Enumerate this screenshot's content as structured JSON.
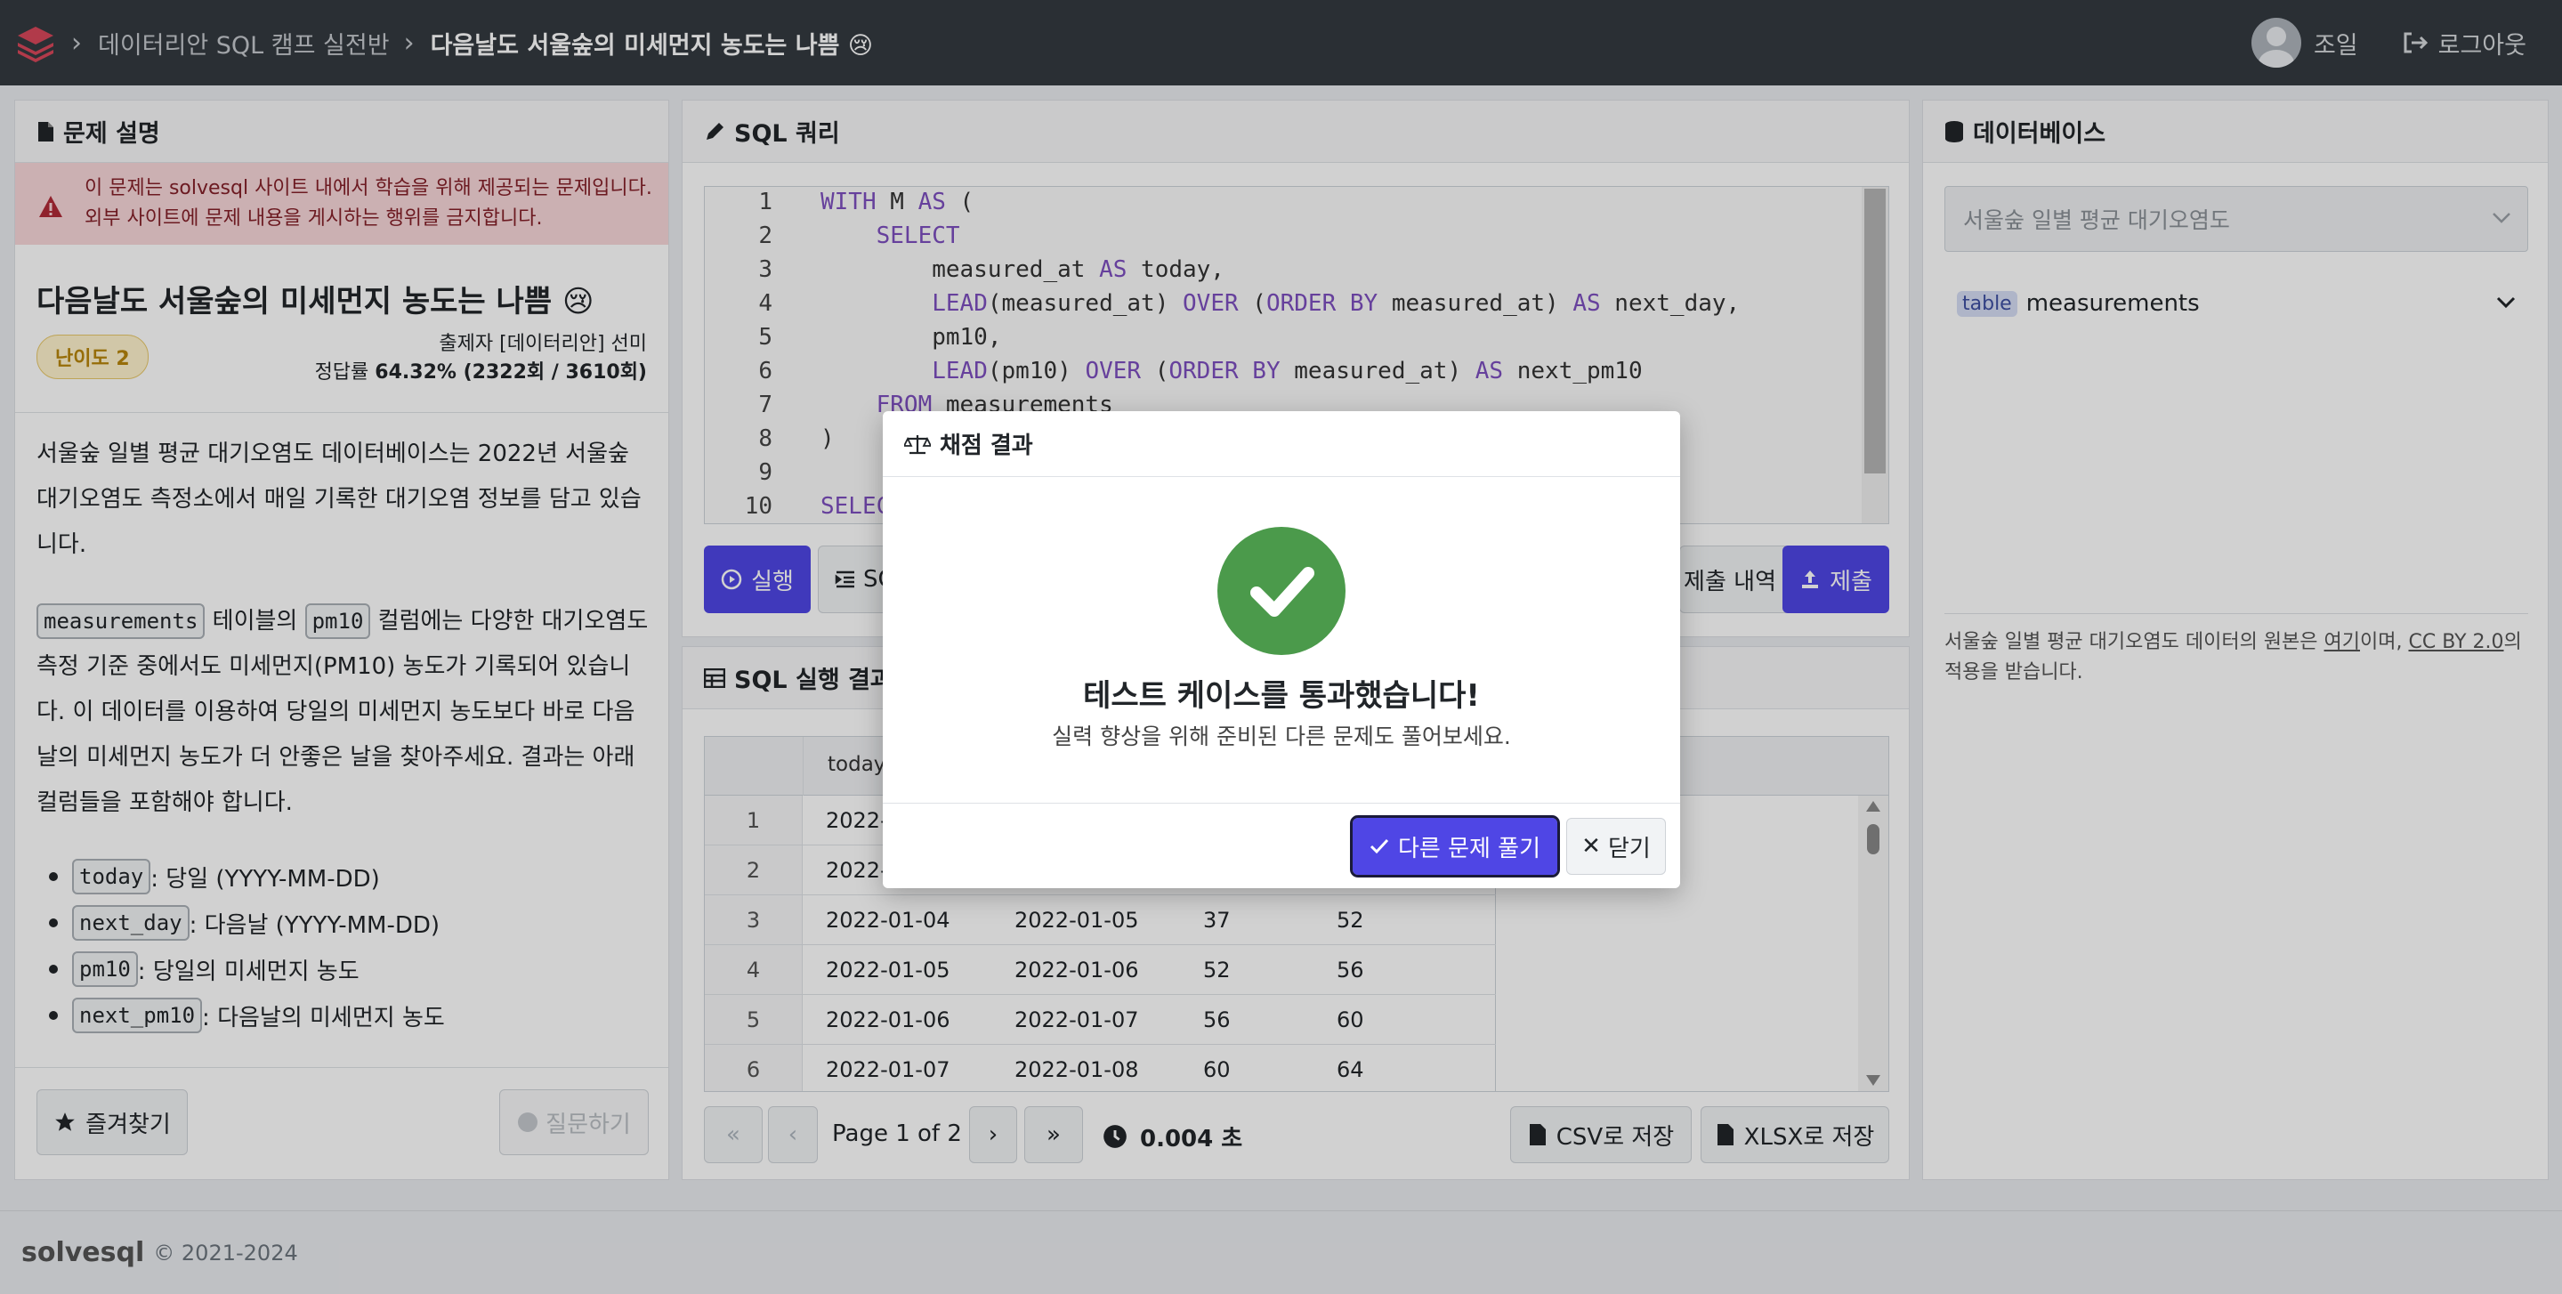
{
  "header": {
    "breadcrumb_course": "데이터리안 SQL 캠프 실전반",
    "breadcrumb_problem": "다음날도 서울숲의 미세먼지 농도는 나쁨 😢",
    "user_name": "조일",
    "logout_label": "로그아웃"
  },
  "left_panel": {
    "title": "문제 설명",
    "alert_line1": "이 문제는 solvesql 사이트 내에서 학습을 위해 제공되는 문제입니다.",
    "alert_line2": "외부 사이트에 문제 내용을 게시하는 행위를 금지합니다.",
    "problem_title": "다음날도 서울숲의 미세먼지 농도는 나쁨 😢",
    "difficulty": "난이도 2",
    "author_label": "출제자",
    "author": "[데이터리안] 선미",
    "accuracy_label": "정답률",
    "accuracy": "64.32% (2322회 / 3610회)",
    "desc_p1": "서울숲 일별 평균 대기오염도 데이터베이스는 2022년 서울숲 대기오염도 측정소에서 매일 기록한 대기오염 정보를 담고 있습니다.",
    "desc_p2_chip1": "measurements",
    "desc_p2_text1": " 테이블의 ",
    "desc_p2_chip2": "pm10",
    "desc_p2_text2": " 컬럼에는 다양한 대기오염도 측정 기준 중에서도 미세먼지(PM10) 농도가 기록되어 있습니다. 이 데이터를 이용하여 당일의 미세먼지 농도보다 바로 다음날의 미세먼지 농도가 더 안좋은 날을 찾아주세요. 결과는 아래 컬럼들을 포함해야 합니다.",
    "bullets": [
      {
        "code": "today",
        "text": ": 당일 (YYYY-MM-DD)"
      },
      {
        "code": "next_day",
        "text": ": 다음날 (YYYY-MM-DD)"
      },
      {
        "code": "pm10",
        "text": ": 당일의 미세먼지 농도"
      },
      {
        "code": "next_pm10",
        "text": ": 다음날의 미세먼지 농도"
      }
    ],
    "bookmark_label": "즐겨찾기",
    "question_label": "질문하기"
  },
  "sql_panel": {
    "title": "SQL 쿼리",
    "line_numbers": [
      "1",
      "2",
      "3",
      "4",
      "5",
      "6",
      "7",
      "8",
      "9",
      "10"
    ],
    "run_label": "실행",
    "format_label_visible": "SQ",
    "history_label_visible": "제출 내역",
    "submit_label": "제출"
  },
  "result_panel": {
    "title_visible": "SQL 실행 결과",
    "col_today_visible": "today",
    "rows": [
      {
        "n": "1",
        "today": "2022-",
        "next_day": "",
        "pm10": "",
        "next_pm10": ""
      },
      {
        "n": "2",
        "today": "2022-",
        "next_day": "",
        "pm10": "",
        "next_pm10": ""
      },
      {
        "n": "3",
        "today": "2022-01-04",
        "next_day": "2022-01-05",
        "pm10": "37",
        "next_pm10": "52"
      },
      {
        "n": "4",
        "today": "2022-01-05",
        "next_day": "2022-01-06",
        "pm10": "52",
        "next_pm10": "56"
      },
      {
        "n": "5",
        "today": "2022-01-06",
        "next_day": "2022-01-07",
        "pm10": "56",
        "next_pm10": "60"
      },
      {
        "n": "6",
        "today": "2022-01-07",
        "next_day": "2022-01-08",
        "pm10": "60",
        "next_pm10": "64"
      }
    ],
    "page_info": "Page 1 of 2",
    "elapsed": "0.004 초",
    "csv_label": "CSV로 저장",
    "xlsx_label": "XLSX로 저장"
  },
  "db_panel": {
    "title": "데이터베이스",
    "db_select": "서울숲 일별 평균 대기오염도",
    "table_chip": "table",
    "table_name": "measurements",
    "note_prefix": "서울숲 일별 평균 대기오염도 데이터의 원본은 ",
    "note_link1": "여기",
    "note_mid": "이며, ",
    "note_link2": "CC BY 2.0",
    "note_suffix": "의",
    "note_line2": "적용을 받습니다."
  },
  "modal": {
    "title": "채점 결과",
    "message": "테스트 케이스를 통과했습니다!",
    "sub_message": "실력 향상을 위해 준비된 다른 문제도 풀어보세요.",
    "next_label": "다른 문제 풀기",
    "close_label": "닫기"
  },
  "footer": {
    "brand": "solvesql",
    "copyright": "© 2021-2024"
  },
  "colors": {
    "topbar": "#343a40",
    "primary": "#4f46e5",
    "success": "#4b9a4b",
    "alert_bg": "#f8d7da"
  }
}
